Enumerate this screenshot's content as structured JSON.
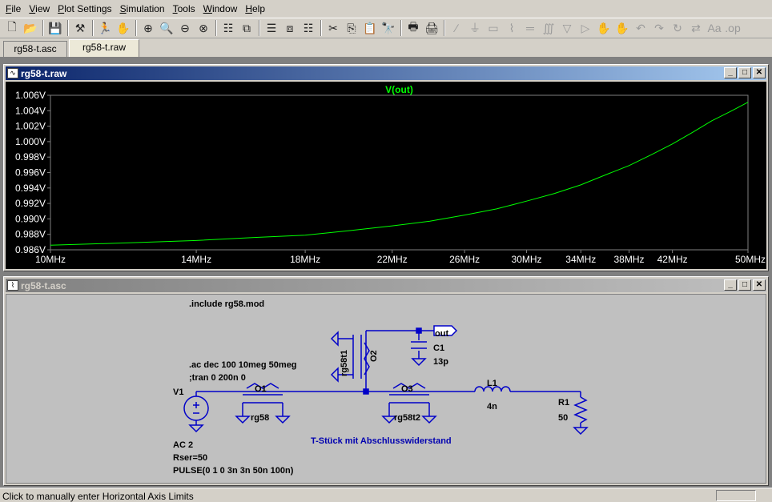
{
  "menu": [
    {
      "label": "File",
      "key": "F",
      "rest": "ile"
    },
    {
      "label": "View",
      "key": "V",
      "rest": "iew"
    },
    {
      "label": "Plot Settings",
      "key": "P",
      "rest": "lot Settings"
    },
    {
      "label": "Simulation",
      "key": "S",
      "rest": "imulation"
    },
    {
      "label": "Tools",
      "key": "T",
      "rest": "ools"
    },
    {
      "label": "Window",
      "key": "W",
      "rest": "indow"
    },
    {
      "label": "Help",
      "key": "H",
      "rest": "elp"
    }
  ],
  "tabs": [
    {
      "label": "rg58-t.asc"
    },
    {
      "label": "rg58-t.raw"
    }
  ],
  "plot_window": {
    "title": "rg58-t.raw",
    "trace_label": "V(out)",
    "trace_color": "#00ff00"
  },
  "chart_data": {
    "type": "line",
    "title": "V(out)",
    "xscale": "log",
    "x_ticks": [
      "10MHz",
      "14MHz",
      "18MHz",
      "22MHz",
      "26MHz",
      "30MHz",
      "34MHz",
      "38MHz",
      "42MHz",
      "50MHz"
    ],
    "x_tick_values": [
      10,
      14,
      18,
      22,
      26,
      30,
      34,
      38,
      42,
      50
    ],
    "y_ticks": [
      "0.986V",
      "0.988V",
      "0.990V",
      "0.992V",
      "0.994V",
      "0.996V",
      "0.998V",
      "1.000V",
      "1.002V",
      "1.004V",
      "1.006V"
    ],
    "y_tick_values": [
      0.986,
      0.988,
      0.99,
      0.992,
      0.994,
      0.996,
      0.998,
      1.0,
      1.002,
      1.004,
      1.006
    ],
    "xlim": [
      10,
      50
    ],
    "ylim": [
      0.986,
      1.006
    ],
    "series": [
      {
        "name": "V(out)",
        "x": [
          10,
          12,
          14,
          16,
          18,
          20,
          22,
          24,
          26,
          28,
          30,
          32,
          34,
          36,
          38,
          40,
          42,
          44,
          46,
          48,
          50
        ],
        "y": [
          0.9866,
          0.9869,
          0.9872,
          0.9876,
          0.9879,
          0.9885,
          0.9891,
          0.9897,
          0.9905,
          0.9913,
          0.9923,
          0.9933,
          0.9944,
          0.9957,
          0.9969,
          0.9983,
          0.9997,
          1.0012,
          1.0027,
          1.0039,
          1.0051
        ]
      }
    ],
    "grid": false
  },
  "schematic_window": {
    "title": "rg58-t.asc",
    "directive_include": ".include rg58.mod",
    "directive_ac": ".ac dec 100 10meg 50meg",
    "directive_tran": ";tran 0 200n 0",
    "label_v1": "V1",
    "v1_ac": "AC 2",
    "v1_rser": "Rser=50",
    "v1_pulse": "PULSE(0 1 0 3n 3n 50n 100n)",
    "label_o1": "O1",
    "model_o1": "rg58",
    "label_o2": "O2",
    "model_o2": "rg58t1",
    "label_o3": "O3",
    "model_o3": "rg58t2",
    "label_c1": "C1",
    "value_c1": "13p",
    "label_l1": "L1",
    "value_l1": "4n",
    "label_r1": "R1",
    "value_r1": "50",
    "net_out": "out",
    "comment": "T-Stück mit Abschlusswiderstand"
  },
  "status": {
    "text": "Click to manually enter Horizontal Axis Limits"
  }
}
